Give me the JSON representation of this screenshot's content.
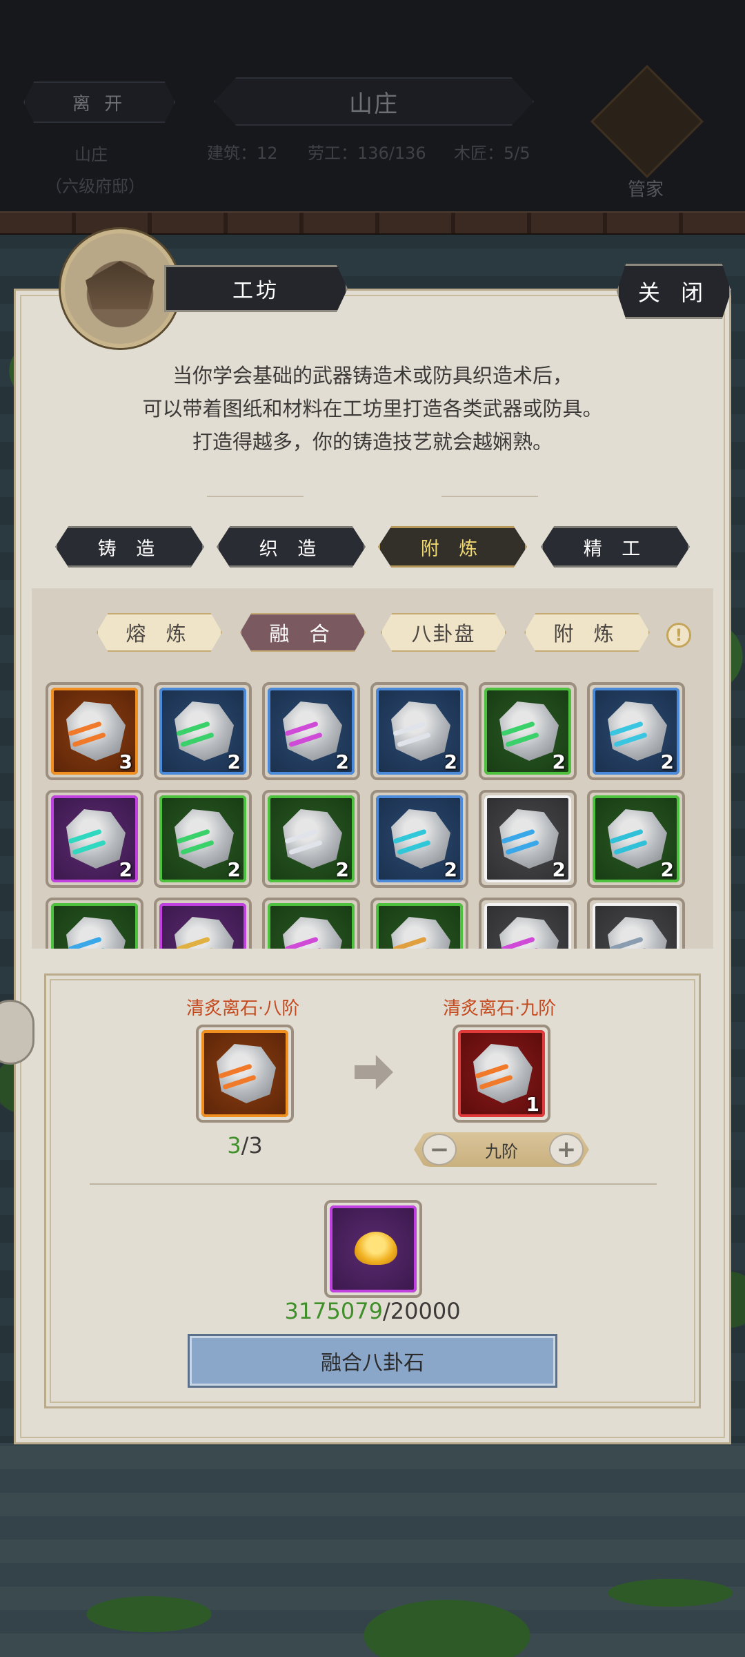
{
  "top": {
    "leave_label": "离 开",
    "estate_title": "山庄",
    "estate_name": "山庄",
    "estate_rank": "（六级府邸）",
    "stat_buildings": "建筑：12",
    "stat_workers": "劳工：136/136",
    "stat_carpenters": "木匠：5/5",
    "steward_label": "管家"
  },
  "panel": {
    "title": "工坊",
    "close_label": "关 闭",
    "description": [
      "当你学会基础的武器铸造术或防具织造术后，",
      "可以带着图纸和材料在工坊里打造各类武器或防具。",
      "打造得越多，你的铸造技艺就会越娴熟。"
    ]
  },
  "main_tabs": [
    {
      "label": "铸 造",
      "active": false
    },
    {
      "label": "织 造",
      "active": false
    },
    {
      "label": "附 炼",
      "active": true
    },
    {
      "label": "精 工",
      "active": false
    }
  ],
  "sub_tabs": [
    {
      "label": "熔 炼",
      "active": false
    },
    {
      "label": "融 合",
      "active": true
    },
    {
      "label": "八卦盘",
      "active": false
    },
    {
      "label": "附 炼",
      "active": false
    }
  ],
  "info_symbol": "!",
  "inventory": [
    {
      "rarity": "orange",
      "vein": "#f07a2a",
      "count": "3"
    },
    {
      "rarity": "blue",
      "vein": "#3ad06a",
      "count": "2"
    },
    {
      "rarity": "blue",
      "vein": "#d04ad8",
      "count": "2"
    },
    {
      "rarity": "blue",
      "vein": "#e0e4ea",
      "count": "2"
    },
    {
      "rarity": "green",
      "vein": "#3ad06a",
      "count": "2"
    },
    {
      "rarity": "blue",
      "vein": "#3ac6e0",
      "count": "2"
    },
    {
      "rarity": "purple",
      "vein": "#30d8c0",
      "count": "2"
    },
    {
      "rarity": "green",
      "vein": "#3ad06a",
      "count": "2"
    },
    {
      "rarity": "green",
      "vein": "#e0e4ea",
      "count": "2"
    },
    {
      "rarity": "blue",
      "vein": "#30c8d8",
      "count": "2"
    },
    {
      "rarity": "white",
      "vein": "#3aa8e8",
      "count": "2"
    },
    {
      "rarity": "green",
      "vein": "#30c0d8",
      "count": "2"
    },
    {
      "rarity": "green",
      "vein": "#3aa8e8",
      "count": ""
    },
    {
      "rarity": "purple",
      "vein": "#e0b040",
      "count": ""
    },
    {
      "rarity": "green",
      "vein": "#d04ad8",
      "count": ""
    },
    {
      "rarity": "green",
      "vein": "#e0a040",
      "count": ""
    },
    {
      "rarity": "white",
      "vein": "#d04ad8",
      "count": ""
    },
    {
      "rarity": "white",
      "vein": "#8a9cb0",
      "count": ""
    }
  ],
  "fusion": {
    "source_name": "清炙离石·八阶",
    "target_name": "清炙离石·九阶",
    "have": "3",
    "need": "/3",
    "target_count": "1",
    "level_label": "九阶",
    "minus_symbol": "−",
    "plus_symbol": "+",
    "cost_have": "3175079",
    "cost_need": "/20000",
    "action_label": "融合八卦石"
  },
  "colors": {
    "accent_gold": "#f0d870",
    "label_red": "#c44a1f",
    "enough_green": "#3f8f2a",
    "button_blue": "#8aa6c8"
  }
}
